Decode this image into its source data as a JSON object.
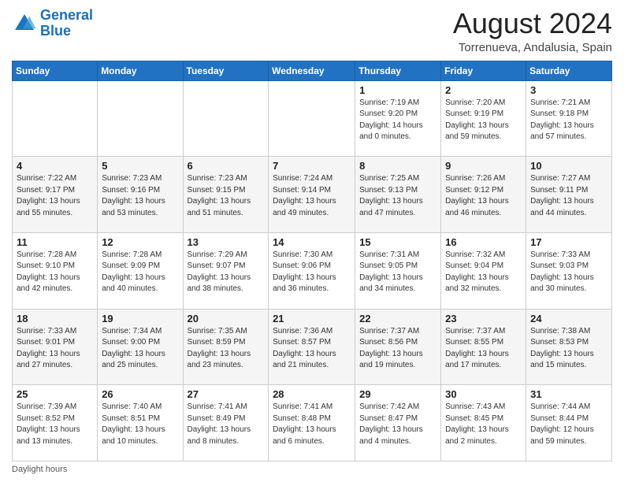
{
  "logo": {
    "line1": "General",
    "line2": "Blue"
  },
  "title": "August 2024",
  "subtitle": "Torrenueva, Andalusia, Spain",
  "days_of_week": [
    "Sunday",
    "Monday",
    "Tuesday",
    "Wednesday",
    "Thursday",
    "Friday",
    "Saturday"
  ],
  "footer_label": "Daylight hours",
  "weeks": [
    [
      {
        "day": "",
        "sunrise": "",
        "sunset": "",
        "daylight": ""
      },
      {
        "day": "",
        "sunrise": "",
        "sunset": "",
        "daylight": ""
      },
      {
        "day": "",
        "sunrise": "",
        "sunset": "",
        "daylight": ""
      },
      {
        "day": "",
        "sunrise": "",
        "sunset": "",
        "daylight": ""
      },
      {
        "day": "1",
        "sunrise": "Sunrise: 7:19 AM",
        "sunset": "Sunset: 9:20 PM",
        "daylight": "Daylight: 14 hours and 0 minutes."
      },
      {
        "day": "2",
        "sunrise": "Sunrise: 7:20 AM",
        "sunset": "Sunset: 9:19 PM",
        "daylight": "Daylight: 13 hours and 59 minutes."
      },
      {
        "day": "3",
        "sunrise": "Sunrise: 7:21 AM",
        "sunset": "Sunset: 9:18 PM",
        "daylight": "Daylight: 13 hours and 57 minutes."
      }
    ],
    [
      {
        "day": "4",
        "sunrise": "Sunrise: 7:22 AM",
        "sunset": "Sunset: 9:17 PM",
        "daylight": "Daylight: 13 hours and 55 minutes."
      },
      {
        "day": "5",
        "sunrise": "Sunrise: 7:23 AM",
        "sunset": "Sunset: 9:16 PM",
        "daylight": "Daylight: 13 hours and 53 minutes."
      },
      {
        "day": "6",
        "sunrise": "Sunrise: 7:23 AM",
        "sunset": "Sunset: 9:15 PM",
        "daylight": "Daylight: 13 hours and 51 minutes."
      },
      {
        "day": "7",
        "sunrise": "Sunrise: 7:24 AM",
        "sunset": "Sunset: 9:14 PM",
        "daylight": "Daylight: 13 hours and 49 minutes."
      },
      {
        "day": "8",
        "sunrise": "Sunrise: 7:25 AM",
        "sunset": "Sunset: 9:13 PM",
        "daylight": "Daylight: 13 hours and 47 minutes."
      },
      {
        "day": "9",
        "sunrise": "Sunrise: 7:26 AM",
        "sunset": "Sunset: 9:12 PM",
        "daylight": "Daylight: 13 hours and 46 minutes."
      },
      {
        "day": "10",
        "sunrise": "Sunrise: 7:27 AM",
        "sunset": "Sunset: 9:11 PM",
        "daylight": "Daylight: 13 hours and 44 minutes."
      }
    ],
    [
      {
        "day": "11",
        "sunrise": "Sunrise: 7:28 AM",
        "sunset": "Sunset: 9:10 PM",
        "daylight": "Daylight: 13 hours and 42 minutes."
      },
      {
        "day": "12",
        "sunrise": "Sunrise: 7:28 AM",
        "sunset": "Sunset: 9:09 PM",
        "daylight": "Daylight: 13 hours and 40 minutes."
      },
      {
        "day": "13",
        "sunrise": "Sunrise: 7:29 AM",
        "sunset": "Sunset: 9:07 PM",
        "daylight": "Daylight: 13 hours and 38 minutes."
      },
      {
        "day": "14",
        "sunrise": "Sunrise: 7:30 AM",
        "sunset": "Sunset: 9:06 PM",
        "daylight": "Daylight: 13 hours and 36 minutes."
      },
      {
        "day": "15",
        "sunrise": "Sunrise: 7:31 AM",
        "sunset": "Sunset: 9:05 PM",
        "daylight": "Daylight: 13 hours and 34 minutes."
      },
      {
        "day": "16",
        "sunrise": "Sunrise: 7:32 AM",
        "sunset": "Sunset: 9:04 PM",
        "daylight": "Daylight: 13 hours and 32 minutes."
      },
      {
        "day": "17",
        "sunrise": "Sunrise: 7:33 AM",
        "sunset": "Sunset: 9:03 PM",
        "daylight": "Daylight: 13 hours and 30 minutes."
      }
    ],
    [
      {
        "day": "18",
        "sunrise": "Sunrise: 7:33 AM",
        "sunset": "Sunset: 9:01 PM",
        "daylight": "Daylight: 13 hours and 27 minutes."
      },
      {
        "day": "19",
        "sunrise": "Sunrise: 7:34 AM",
        "sunset": "Sunset: 9:00 PM",
        "daylight": "Daylight: 13 hours and 25 minutes."
      },
      {
        "day": "20",
        "sunrise": "Sunrise: 7:35 AM",
        "sunset": "Sunset: 8:59 PM",
        "daylight": "Daylight: 13 hours and 23 minutes."
      },
      {
        "day": "21",
        "sunrise": "Sunrise: 7:36 AM",
        "sunset": "Sunset: 8:57 PM",
        "daylight": "Daylight: 13 hours and 21 minutes."
      },
      {
        "day": "22",
        "sunrise": "Sunrise: 7:37 AM",
        "sunset": "Sunset: 8:56 PM",
        "daylight": "Daylight: 13 hours and 19 minutes."
      },
      {
        "day": "23",
        "sunrise": "Sunrise: 7:37 AM",
        "sunset": "Sunset: 8:55 PM",
        "daylight": "Daylight: 13 hours and 17 minutes."
      },
      {
        "day": "24",
        "sunrise": "Sunrise: 7:38 AM",
        "sunset": "Sunset: 8:53 PM",
        "daylight": "Daylight: 13 hours and 15 minutes."
      }
    ],
    [
      {
        "day": "25",
        "sunrise": "Sunrise: 7:39 AM",
        "sunset": "Sunset: 8:52 PM",
        "daylight": "Daylight: 13 hours and 13 minutes."
      },
      {
        "day": "26",
        "sunrise": "Sunrise: 7:40 AM",
        "sunset": "Sunset: 8:51 PM",
        "daylight": "Daylight: 13 hours and 10 minutes."
      },
      {
        "day": "27",
        "sunrise": "Sunrise: 7:41 AM",
        "sunset": "Sunset: 8:49 PM",
        "daylight": "Daylight: 13 hours and 8 minutes."
      },
      {
        "day": "28",
        "sunrise": "Sunrise: 7:41 AM",
        "sunset": "Sunset: 8:48 PM",
        "daylight": "Daylight: 13 hours and 6 minutes."
      },
      {
        "day": "29",
        "sunrise": "Sunrise: 7:42 AM",
        "sunset": "Sunset: 8:47 PM",
        "daylight": "Daylight: 13 hours and 4 minutes."
      },
      {
        "day": "30",
        "sunrise": "Sunrise: 7:43 AM",
        "sunset": "Sunset: 8:45 PM",
        "daylight": "Daylight: 13 hours and 2 minutes."
      },
      {
        "day": "31",
        "sunrise": "Sunrise: 7:44 AM",
        "sunset": "Sunset: 8:44 PM",
        "daylight": "Daylight: 12 hours and 59 minutes."
      }
    ]
  ]
}
